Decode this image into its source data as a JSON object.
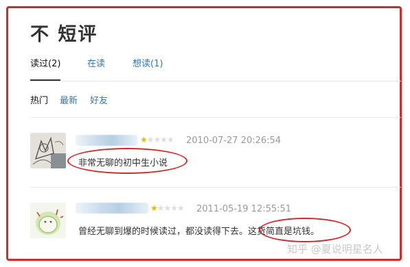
{
  "page": {
    "title": "不 短评"
  },
  "tabs": [
    {
      "label": "读过(2)",
      "active": true
    },
    {
      "label": "在读",
      "active": false
    },
    {
      "label": "想读(1)",
      "active": false
    }
  ],
  "filters": [
    {
      "label": "热门",
      "active": true
    },
    {
      "label": "最新",
      "active": false
    },
    {
      "label": "好友",
      "active": false
    }
  ],
  "reviews": [
    {
      "rating": 1,
      "rating_max": 5,
      "date": "2010-07-27 20:26:54",
      "comment": "非常无聊的初中生小说"
    },
    {
      "rating": 1,
      "rating_max": 5,
      "date": "2011-05-19 12:55:51",
      "comment": "曾经无聊到爆的时候读过，都没读得下去。这货简直是坑钱。"
    }
  ],
  "watermark": "知乎 @夏说明星名人",
  "colors": {
    "highlight_border": "#d62828",
    "link": "#3377aa",
    "star_on": "#f0b400",
    "star_off": "#dddddd"
  }
}
